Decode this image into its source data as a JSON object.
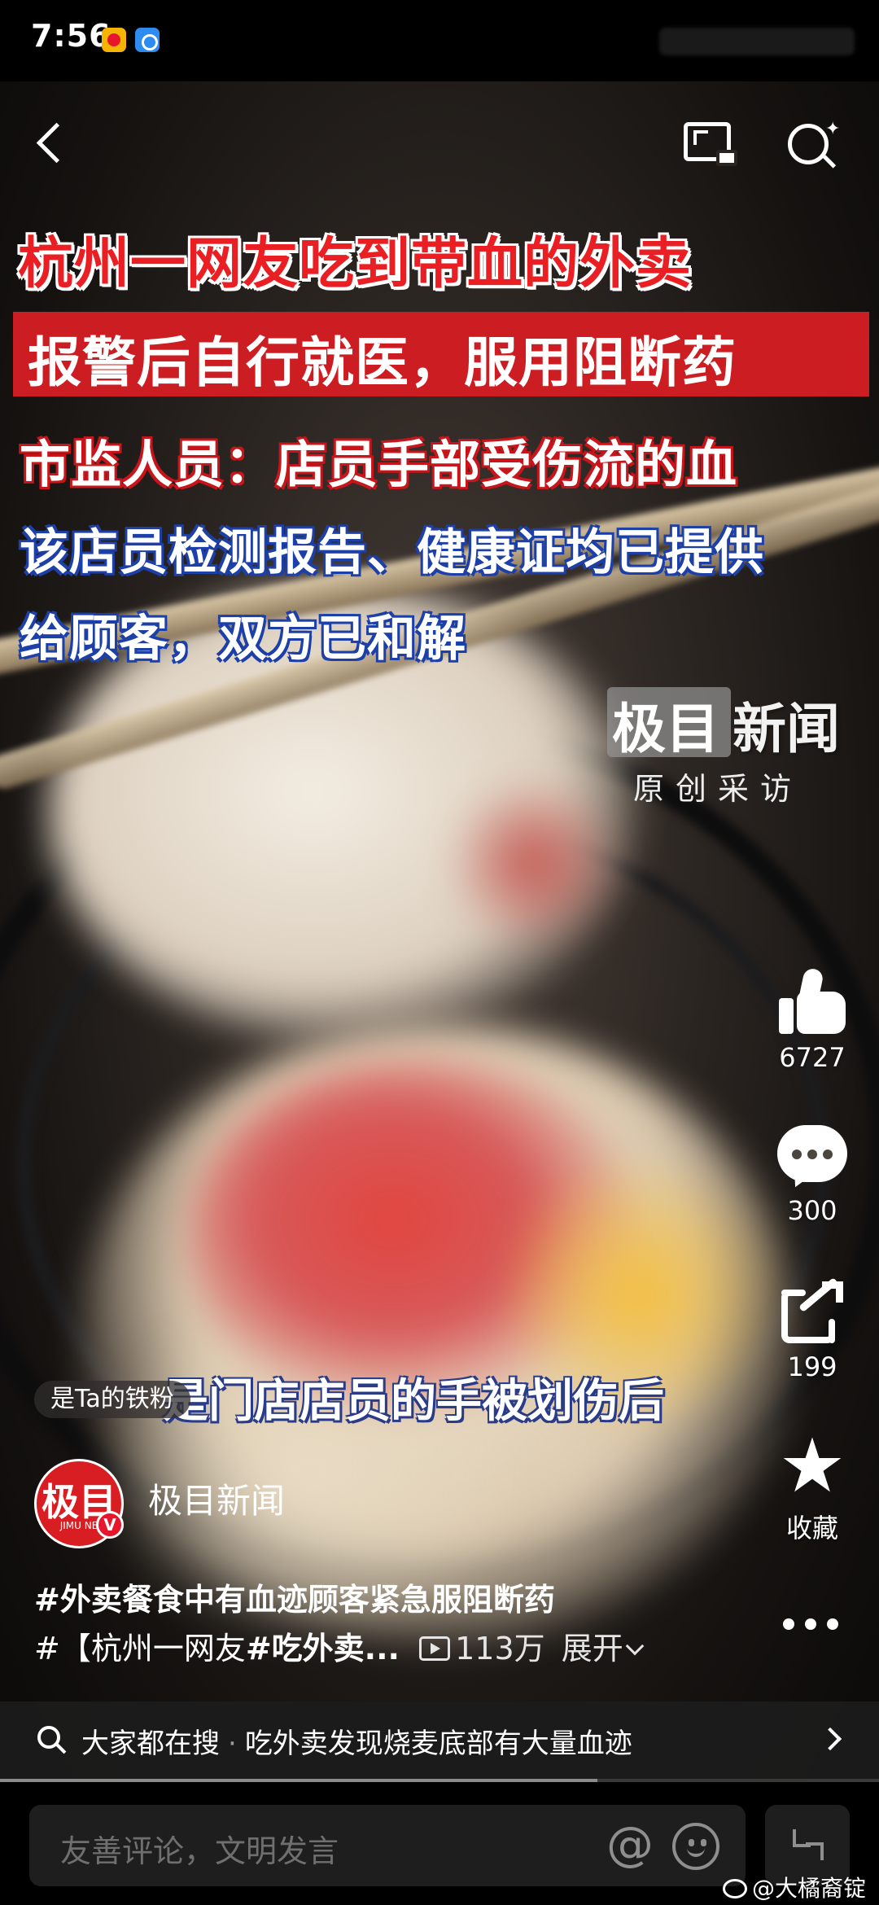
{
  "status_bar": {
    "time": "7:56",
    "icons": [
      "weibo-app-icon",
      "browser-app-icon"
    ]
  },
  "video": {
    "headlines": [
      "杭州一网友吃到带血的外卖",
      "报警后自行就医，服用阻断药",
      "市监人员：店员手部受伤流的血",
      "该店员检测报告、健康证均已提供",
      "给顾客，双方已和解"
    ],
    "headline_colors": {
      "title_red": "#ea1f24",
      "banner_red": "#cc1e22",
      "outline_blue": "#1d3fa8"
    },
    "watermark": {
      "brand_a": "极目",
      "brand_b": "新闻",
      "sub": "原创采访"
    },
    "subtitle": "是门店店员的手被划伤后",
    "fan_badge": "是Ta的铁粉",
    "progress": 0.68
  },
  "actions": {
    "like_count": "6727",
    "comment_count": "300",
    "share_count": "199",
    "favorite_label": "收藏"
  },
  "author": {
    "avatar_text": "极目",
    "avatar_sub": "JIMU NE",
    "verified_mark": "V",
    "name": "极目新闻"
  },
  "caption": {
    "line1": "#外卖餐食中有血迹顾客紧急服阻断药",
    "line2_hash": "#【杭州一网友",
    "line2_tag": "#吃外卖...",
    "play_count": "113万",
    "expand": "展开"
  },
  "search_suggestion": {
    "label": "大家都在搜",
    "separator": "·",
    "query": "吃外卖发现烧麦底部有大量血迹"
  },
  "comment_bar": {
    "placeholder": "友善评论，文明发言",
    "at_symbol": "@"
  },
  "repost_credit": "@大橘裔锭"
}
